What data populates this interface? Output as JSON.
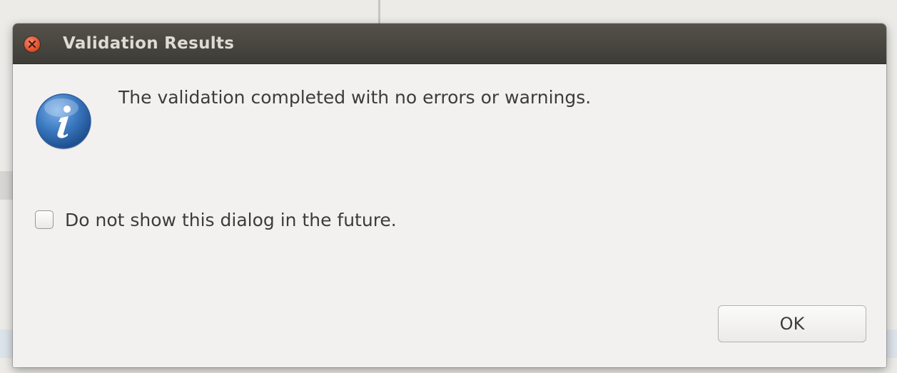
{
  "dialog": {
    "title": "Validation Results",
    "message": "The validation completed with no errors or warnings.",
    "checkbox": {
      "label": "Do not show this dialog in the future.",
      "checked": false
    },
    "buttons": {
      "ok_label": "OK"
    },
    "icons": {
      "close": "close-icon",
      "info": "info-icon"
    }
  },
  "colors": {
    "titlebar": "#3d3c37",
    "title_text": "#dfdbd2",
    "close_button": "#dc4a24",
    "info_icon": "#2f6db5",
    "dialog_background": "#f2f1f0"
  }
}
